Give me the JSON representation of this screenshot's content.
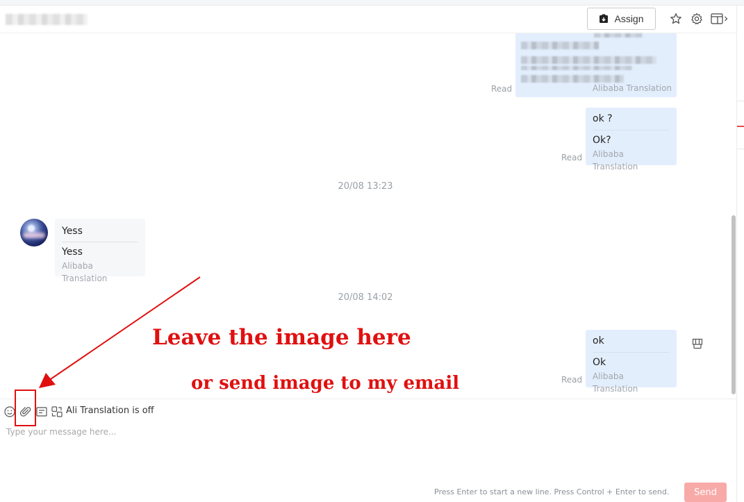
{
  "header": {
    "assign_label": "Assign",
    "icons": [
      "assign-icon",
      "star-icon",
      "gear-icon",
      "panel-toggle-icon"
    ]
  },
  "messages": [
    {
      "id": "m1",
      "direction": "outgoing",
      "status": "Read",
      "source": "Alibaba Translation"
    },
    {
      "id": "m2",
      "direction": "outgoing",
      "original": "ok ?",
      "translated": "Ok?",
      "source": "Alibaba Translation",
      "status": "Read"
    },
    {
      "id": "ts1",
      "type": "timestamp",
      "text": "20/08 13:23"
    },
    {
      "id": "m3",
      "direction": "incoming",
      "original": "Yess",
      "translated": "Yess",
      "source": "Alibaba Translation"
    },
    {
      "id": "ts2",
      "type": "timestamp",
      "text": "20/08 14:02"
    },
    {
      "id": "m4",
      "direction": "outgoing",
      "original": "ok",
      "translated": "Ok",
      "source": "Alibaba Translation",
      "status": "Read"
    }
  ],
  "annotations": {
    "line1": "Leave the image here",
    "line2": "or send image to my email",
    "color": "#e01010"
  },
  "composer": {
    "translation_status": "Ali Translation is off",
    "placeholder": "Type your message here...",
    "hint": "Press Enter to start a new line. Press Control + Enter to send.",
    "send_label": "Send",
    "toolbar_icons": [
      "emoji-icon",
      "attachment-icon",
      "quick-reply-icon",
      "translate-icon"
    ]
  },
  "colors": {
    "outgoing_bubble": "#e3eefd",
    "incoming_bubble": "#f6f7f8",
    "send_button": "#f8aaa8",
    "accent_red": "#e94b4b"
  }
}
